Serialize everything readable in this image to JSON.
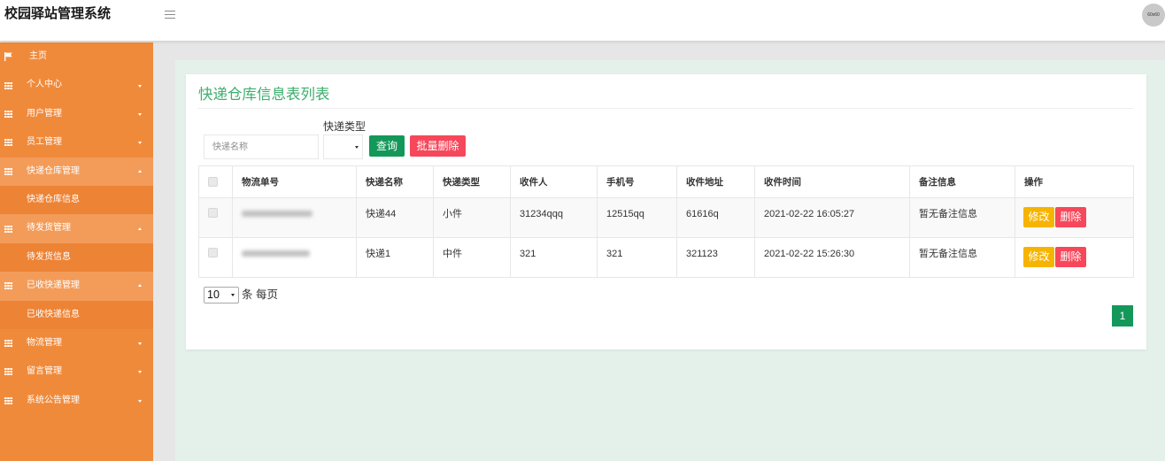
{
  "app": {
    "title": "校园驿站管理系统",
    "avatar_text": "60x60",
    "menu_icon": "hamburger-icon"
  },
  "sidebar": {
    "items": [
      {
        "label": "主页",
        "icon": "flag-icon"
      },
      {
        "label": "个人中心",
        "icon": "grid-icon",
        "caret": "chevron-down-icon"
      },
      {
        "label": "用户管理",
        "icon": "grid-icon",
        "caret": "chevron-down-icon"
      },
      {
        "label": "员工管理",
        "icon": "grid-icon",
        "caret": "chevron-down-icon"
      },
      {
        "label": "快递仓库管理",
        "icon": "grid-icon",
        "caret": "chevron-up-icon",
        "children": [
          {
            "label": "快递仓库信息"
          }
        ]
      },
      {
        "label": "待发货管理",
        "icon": "grid-icon",
        "caret": "chevron-up-icon",
        "children": [
          {
            "label": "待发货信息"
          }
        ]
      },
      {
        "label": "已收快递管理",
        "icon": "grid-icon",
        "caret": "chevron-up-icon",
        "children": [
          {
            "label": "已收快递信息"
          }
        ]
      },
      {
        "label": "物流管理",
        "icon": "grid-icon",
        "caret": "chevron-down-icon"
      },
      {
        "label": "留言管理",
        "icon": "grid-icon",
        "caret": "chevron-down-icon"
      },
      {
        "label": "系统公告管理",
        "icon": "grid-icon",
        "caret": "chevron-down-icon"
      }
    ]
  },
  "page": {
    "title": "快递仓库信息表列表"
  },
  "search": {
    "name_placeholder": "快递名称",
    "type_label": "快递类型",
    "query_button": "查询",
    "batch_delete_button": "批量删除"
  },
  "table": {
    "columns": [
      "物流单号",
      "快递名称",
      "快递类型",
      "收件人",
      "手机号",
      "收件地址",
      "收件时间",
      "备注信息",
      "操作"
    ],
    "rows": [
      {
        "name": "快递44",
        "type": "小件",
        "recipient": "31234qqq",
        "phone": "12515qq",
        "address": "61616q",
        "time": "2021-02-22 16:05:27",
        "remark": "暂无备注信息"
      },
      {
        "name": "快递1",
        "type": "中件",
        "recipient": "321",
        "phone": "321",
        "address": "321123",
        "time": "2021-02-22 15:26:30",
        "remark": "暂无备注信息"
      }
    ],
    "actions": {
      "edit": "修改",
      "delete": "删除"
    }
  },
  "pagination": {
    "page_size": "10",
    "page_size_suffix": "条 每页",
    "pages": [
      "1"
    ]
  },
  "colors": {
    "sidebar_bg": "#F08A3B",
    "sidebar_group_open": "#F39C5A",
    "sidebar_sub": "#ED8335",
    "title_green": "#3DAE6E",
    "query_green": "#14985A",
    "danger_red": "#F7475A",
    "edit_yellow": "#F6B400",
    "content_bg": "#E4F1EA",
    "outer_bg": "#E6E6E6"
  }
}
